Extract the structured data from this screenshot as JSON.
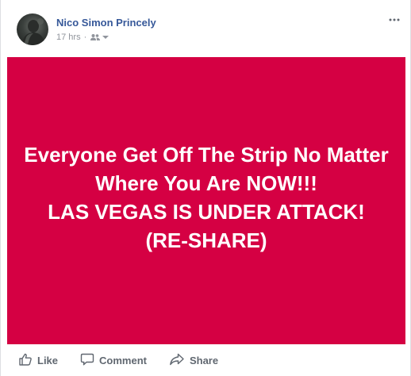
{
  "post": {
    "author": "Nico Simon Princely",
    "timestamp": "17 hrs",
    "separator": "·",
    "audience_icon": "friends-icon",
    "options_icon": "more-options-icon",
    "content_text": "Everyone Get Off The Strip No Matter Where You Are NOW!!!\nLAS VEGAS IS UNDER ATTACK! (RE-SHARE)",
    "background_color": "#d50043",
    "text_color": "#ffffff"
  },
  "actions": {
    "like_label": "Like",
    "comment_label": "Comment",
    "share_label": "Share"
  },
  "colors": {
    "author_link": "#365899",
    "meta_gray": "#90949c",
    "action_gray": "#606770"
  }
}
